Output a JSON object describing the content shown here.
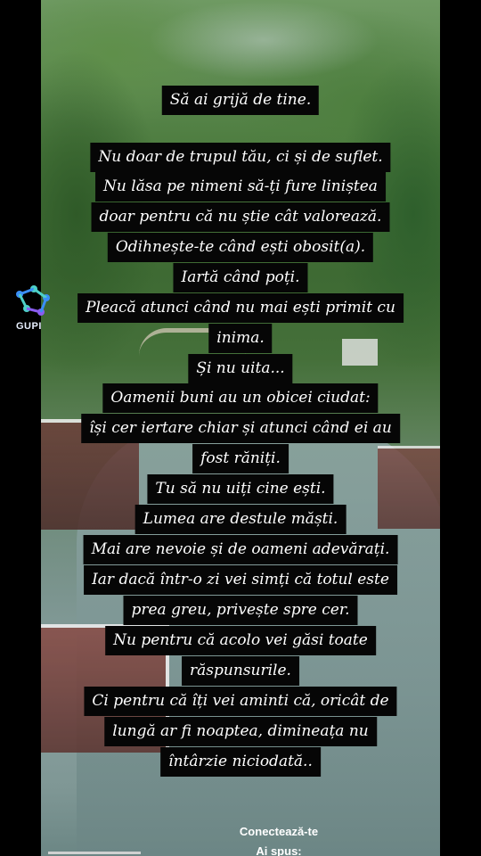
{
  "brand": {
    "logo_text": "GUPI",
    "logo_colors": [
      "#3a8ef6",
      "#4dd0c8",
      "#8a5cf0"
    ]
  },
  "post": {
    "lines": [
      "Să ai grijă de tine.",
      "Nu doar de trupul tău, ci și de suflet.",
      "Nu lăsa pe nimeni să-ți fure liniștea",
      "doar pentru că nu știe cât valorează.",
      "Odihnește-te când ești obosit(a).",
      "Iartă când poți.",
      "Pleacă atunci când nu mai ești primit cu",
      "inima.",
      "Și nu uita...",
      "Oamenii buni au un obicei ciudat:",
      "își cer iertare chiar și atunci când ei au",
      "fost răniți.",
      "Tu să nu uiți cine ești.",
      "Lumea are destule măști.",
      "Mai are nevoie și de oameni adevărați.",
      "Iar dacă într-o zi vei simți că totul este",
      "prea greu, privește spre cer.",
      "Nu pentru că acolo vei găsi toate",
      "răspunsurile.",
      "Ci pentru că îți vei aminti că, oricât de",
      "lungă ar fi noaptea, dimineața nu",
      "întârzie niciodată.."
    ]
  },
  "caption": {
    "line1": "Conectează-te",
    "line2": "Ai spus:"
  }
}
